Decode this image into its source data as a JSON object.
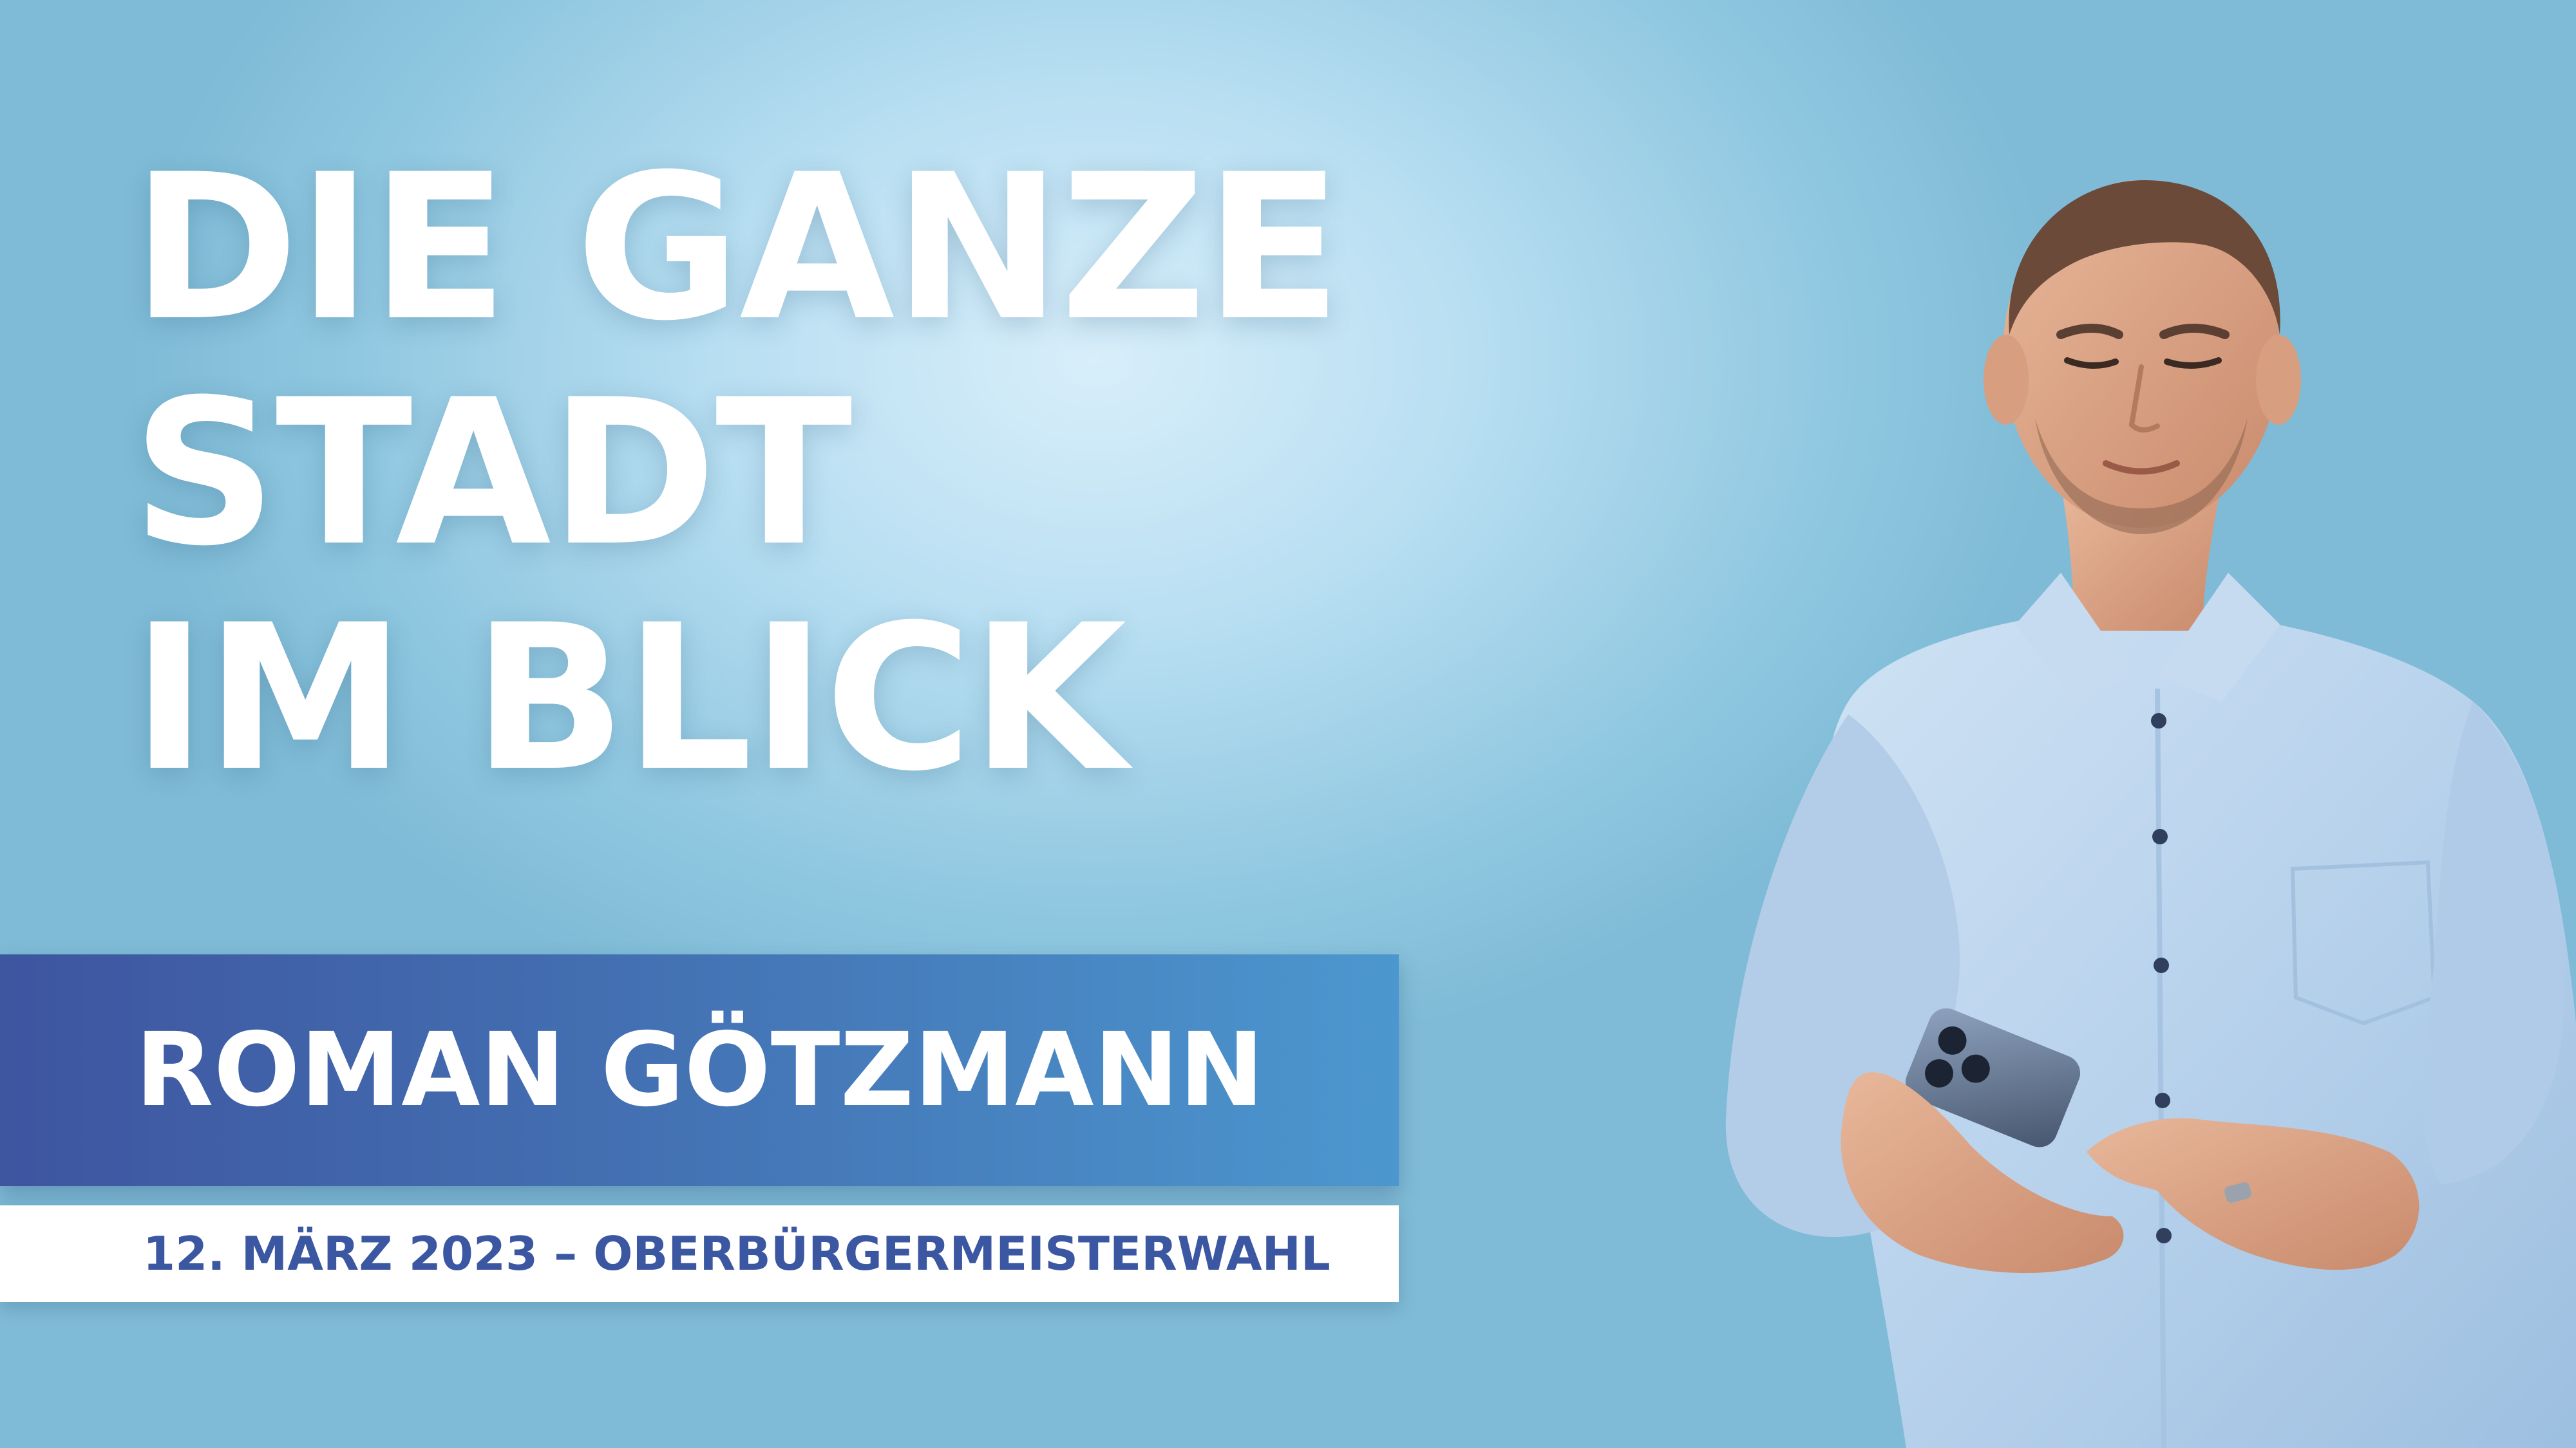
{
  "poster": {
    "headline_lines": [
      "DIE GANZE",
      "STADT",
      "IM BLICK"
    ],
    "candidate_name": "ROMAN GÖTZMANN",
    "election_line": "12. MÄRZ 2023 – OBERBÜRGERMEISTERWAHL"
  },
  "colors": {
    "background": "#b9dff2",
    "banner_start": "#3e55a0",
    "banner_end": "#4c97cf",
    "date_text": "#3c57a1",
    "headline_text": "#ffffff"
  },
  "portrait": {
    "subject": "man-in-light-blue-shirt-holding-smartphone"
  }
}
